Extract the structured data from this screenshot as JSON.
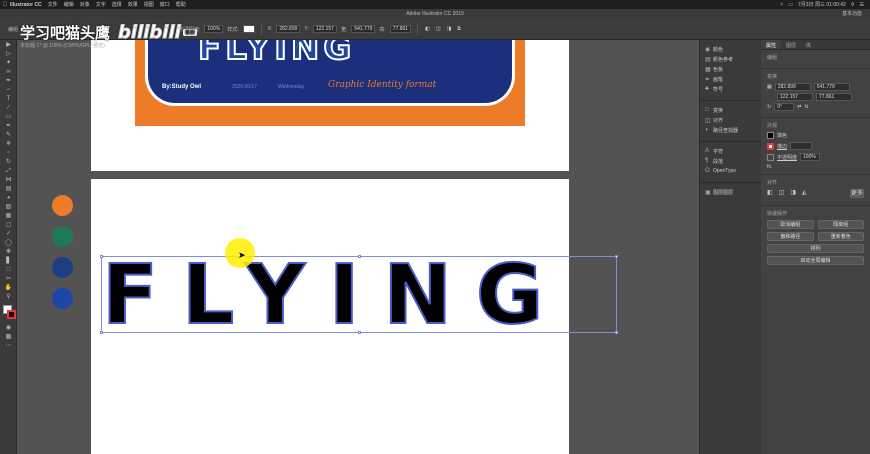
{
  "menubar": {
    "apple": "",
    "app_name": "Illustrator CC",
    "items": [
      "文件",
      "编辑",
      "对象",
      "文字",
      "选择",
      "效果",
      "视图",
      "窗口",
      "帮助"
    ],
    "clock": "7月3日 周三 01:00:42"
  },
  "titlebar": {
    "title": "Adobe Illustrator CC 2019",
    "workspace": "基本功能"
  },
  "controlbar": {
    "group_label": "编组",
    "opacity_label": "不透明度:",
    "opacity_value": "100%",
    "style_label": "样式:",
    "x_label": "X:",
    "x_value": "282.899",
    "y_label": "Y:",
    "y_value": "122.157",
    "w_label": "宽:",
    "w_value": "541.779",
    "h_label": "高:",
    "h_value": "77.861"
  },
  "watermark": {
    "channel": "学习吧猫头鹰",
    "brand": "bilibili",
    "badge": "番剧",
    "doc_tab": "未标题-1* @ 100% (CMYK/GPU 预览)"
  },
  "poster": {
    "top_text": "FLYING",
    "by": "By:Study Owl",
    "date": "2020.06/17",
    "weekday": "Wednesday",
    "script": "Graphic Identity format"
  },
  "artboard2": {
    "headline": "FLYING",
    "swatches": [
      "#ee7b28",
      "#1d7a55",
      "#1c3f82",
      "#1c46a8"
    ]
  },
  "dock": {
    "items": [
      {
        "icon": "color-icon",
        "label": "颜色"
      },
      {
        "icon": "color-guide-icon",
        "label": "颜色参考"
      },
      {
        "icon": "swatches-icon",
        "label": "色板"
      },
      {
        "icon": "brush-icon",
        "label": "画笔"
      },
      {
        "icon": "symbol-icon",
        "label": "符号"
      },
      {
        "icon": "transform-icon",
        "label": "变换"
      },
      {
        "icon": "align-icon",
        "label": "对齐"
      },
      {
        "icon": "pathfinder-icon",
        "label": "路径查找器"
      },
      {
        "icon": "character-icon",
        "label": "字符"
      },
      {
        "icon": "paragraph-icon",
        "label": "段落"
      },
      {
        "icon": "opentype-icon",
        "label": "OpenType"
      },
      {
        "icon": "artboards-icon",
        "label": "图层图层"
      }
    ]
  },
  "props": {
    "tabs": [
      "属性",
      "图层",
      "库"
    ],
    "group_label": "编组",
    "transform_title": "变换",
    "x_value": "282.899",
    "y_value": "122.157",
    "w_value": "541.779",
    "h_value": "77.861",
    "angle_value": "0°",
    "appearance_title": "外观",
    "fill_label": "填色",
    "stroke_label": "描边",
    "opacity_label": "不透明度",
    "opacity_value": "100%",
    "fx_label": "fx.",
    "align_title": "对齐",
    "quick_title": "快速操作",
    "btn_ungroup": "取消编组",
    "btn_isolate": "隔离组",
    "btn_offset": "偏移路径",
    "btn_recolor": "重新着色",
    "btn_arrange": "排列",
    "btn_autotrace": "启动全局编辑",
    "align_more": "更多"
  }
}
